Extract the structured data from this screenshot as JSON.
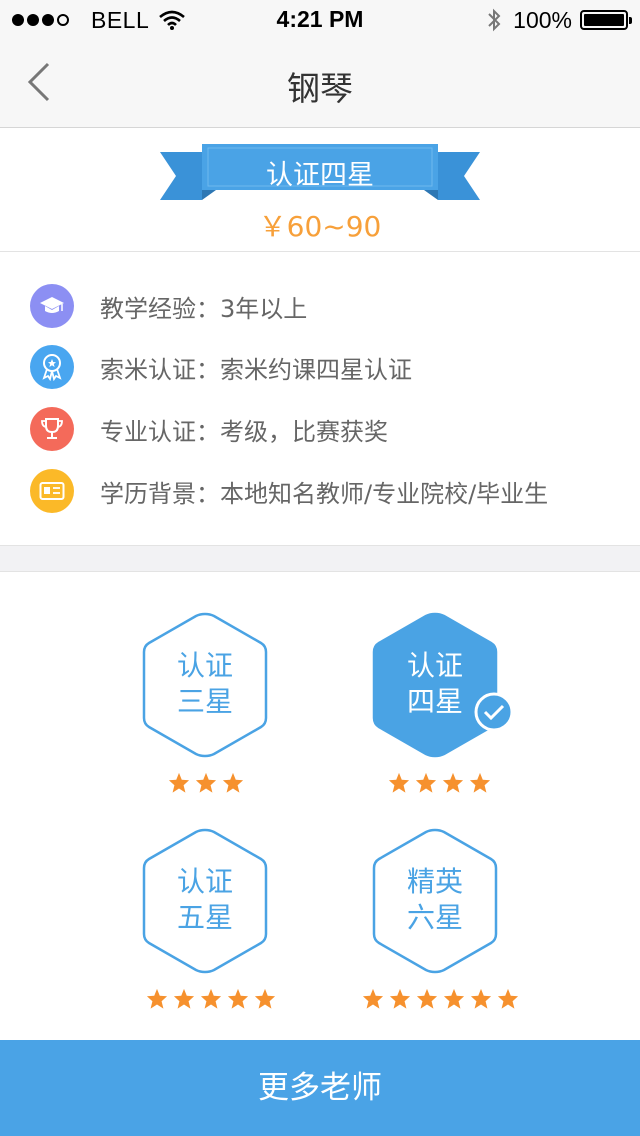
{
  "status_bar": {
    "carrier": "BELL",
    "time": "4:21 PM",
    "battery": "100%"
  },
  "nav": {
    "title": "钢琴",
    "back_icon": "chevron-left-icon"
  },
  "hero": {
    "ribbon_label": "认证四星",
    "price": "￥60~90"
  },
  "info": {
    "items": [
      {
        "label": "教学经验：",
        "value": "3年以上",
        "icon": "graduation-cap-icon",
        "color": "#8c8ff3"
      },
      {
        "label": "索米认证：",
        "value": "索米约课四星认证",
        "icon": "award-ribbon-icon",
        "color": "#49a6f0"
      },
      {
        "label": "专业认证：",
        "value": "考级，比赛获奖",
        "icon": "trophy-icon",
        "color": "#f46a5a"
      },
      {
        "label": "学历背景：",
        "value": "本地知名教师/专业院校/毕业生",
        "icon": "id-card-icon",
        "color": "#fbb928"
      }
    ]
  },
  "badges": {
    "items": [
      {
        "line1": "认证",
        "line2": "三星",
        "stars": 3,
        "selected": false
      },
      {
        "line1": "认证",
        "line2": "四星",
        "stars": 4,
        "selected": true
      },
      {
        "line1": "认证",
        "line2": "五星",
        "stars": 5,
        "selected": false
      },
      {
        "line1": "精英",
        "line2": "六星",
        "stars": 6,
        "selected": false
      }
    ],
    "star_color": "#f6912e",
    "accent": "#4aa3e4"
  },
  "footer": {
    "more_button": "更多老师"
  }
}
